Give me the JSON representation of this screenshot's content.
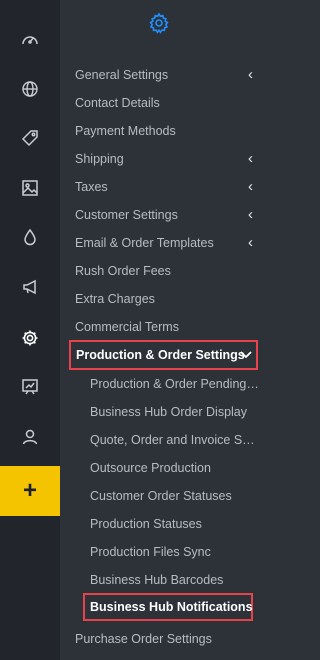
{
  "rail": {
    "items": [
      {
        "icon": "dashboard-gauge-icon"
      },
      {
        "icon": "globe-icon"
      },
      {
        "icon": "tag-icon"
      },
      {
        "icon": "image-icon"
      },
      {
        "icon": "drop-icon"
      },
      {
        "icon": "megaphone-icon"
      },
      {
        "icon": "gear-icon",
        "active": true
      },
      {
        "icon": "presentation-chart-icon"
      },
      {
        "icon": "user-icon"
      }
    ],
    "add_label": "+",
    "add_color": "#f5c400"
  },
  "settings": {
    "header_icon": "gear-icon",
    "accent": "#1e90ff",
    "items": [
      {
        "label": "General Settings",
        "expandable": true
      },
      {
        "label": "Contact Details"
      },
      {
        "label": "Payment Methods"
      },
      {
        "label": "Shipping",
        "expandable": true
      },
      {
        "label": "Taxes",
        "expandable": true
      },
      {
        "label": "Customer Settings",
        "expandable": true
      },
      {
        "label": "Email & Order Templates",
        "expandable": true
      },
      {
        "label": "Rush Order Fees"
      },
      {
        "label": "Extra Charges"
      },
      {
        "label": "Commercial Terms"
      }
    ],
    "active_section": {
      "label": "Production & Order Settings",
      "expanded": true,
      "highlight_color": "#e8424a",
      "subitems": [
        {
          "label": "Production & Order Pending ..."
        },
        {
          "label": "Business Hub Order Display"
        },
        {
          "label": "Quote, Order and Invoice Set..."
        },
        {
          "label": "Outsource Production"
        },
        {
          "label": "Customer Order Statuses"
        },
        {
          "label": "Production Statuses"
        },
        {
          "label": "Production Files Sync"
        },
        {
          "label": "Business Hub Barcodes"
        },
        {
          "label": "Business Hub Notifications",
          "active": true
        }
      ]
    },
    "after_items": [
      {
        "label": "Purchase Order Settings"
      }
    ]
  }
}
